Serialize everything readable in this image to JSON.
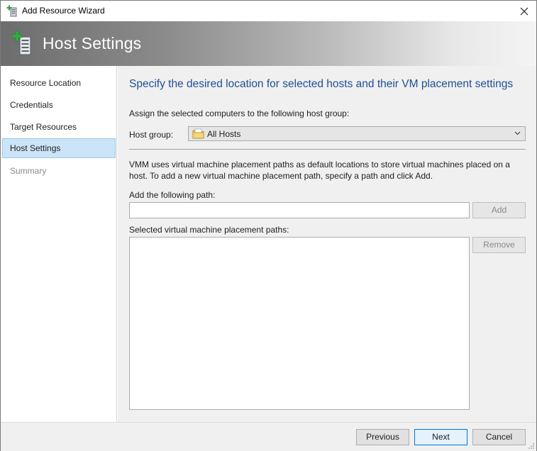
{
  "window": {
    "title": "Add Resource Wizard"
  },
  "banner": {
    "heading": "Host Settings"
  },
  "nav": {
    "items": [
      {
        "label": "Resource Location",
        "state": "normal"
      },
      {
        "label": "Credentials",
        "state": "normal"
      },
      {
        "label": "Target Resources",
        "state": "normal"
      },
      {
        "label": "Host Settings",
        "state": "active"
      },
      {
        "label": "Summary",
        "state": "disabled"
      }
    ]
  },
  "main": {
    "heading": "Specify the desired location for selected hosts and their VM placement settings",
    "assign_label": "Assign the selected computers to the following host group:",
    "host_group_label": "Host group:",
    "host_group_value": "All Hosts",
    "description": "VMM uses virtual machine placement paths as default locations to store virtual machines placed on a host. To add a new virtual machine placement path, specify a path and click Add.",
    "add_path_label": "Add the following path:",
    "add_path_value": "",
    "add_button": "Add",
    "selected_paths_label": "Selected virtual machine placement paths:",
    "selected_paths": [],
    "remove_button": "Remove"
  },
  "footer": {
    "previous_button": "Previous",
    "next_button": "Next",
    "cancel_button": "Cancel"
  },
  "icons": {
    "app": "add-host-icon",
    "banner": "add-host-icon",
    "host_group": "folder-icon",
    "close": "close-icon",
    "dropdown": "chevron-down-icon"
  },
  "colors": {
    "heading": "#1f4e96",
    "active_nav_bg": "#cce4f7",
    "active_nav_border": "#99c9ef",
    "panel_bg": "#f0f0f0",
    "primary_button_border": "#0078d7"
  }
}
